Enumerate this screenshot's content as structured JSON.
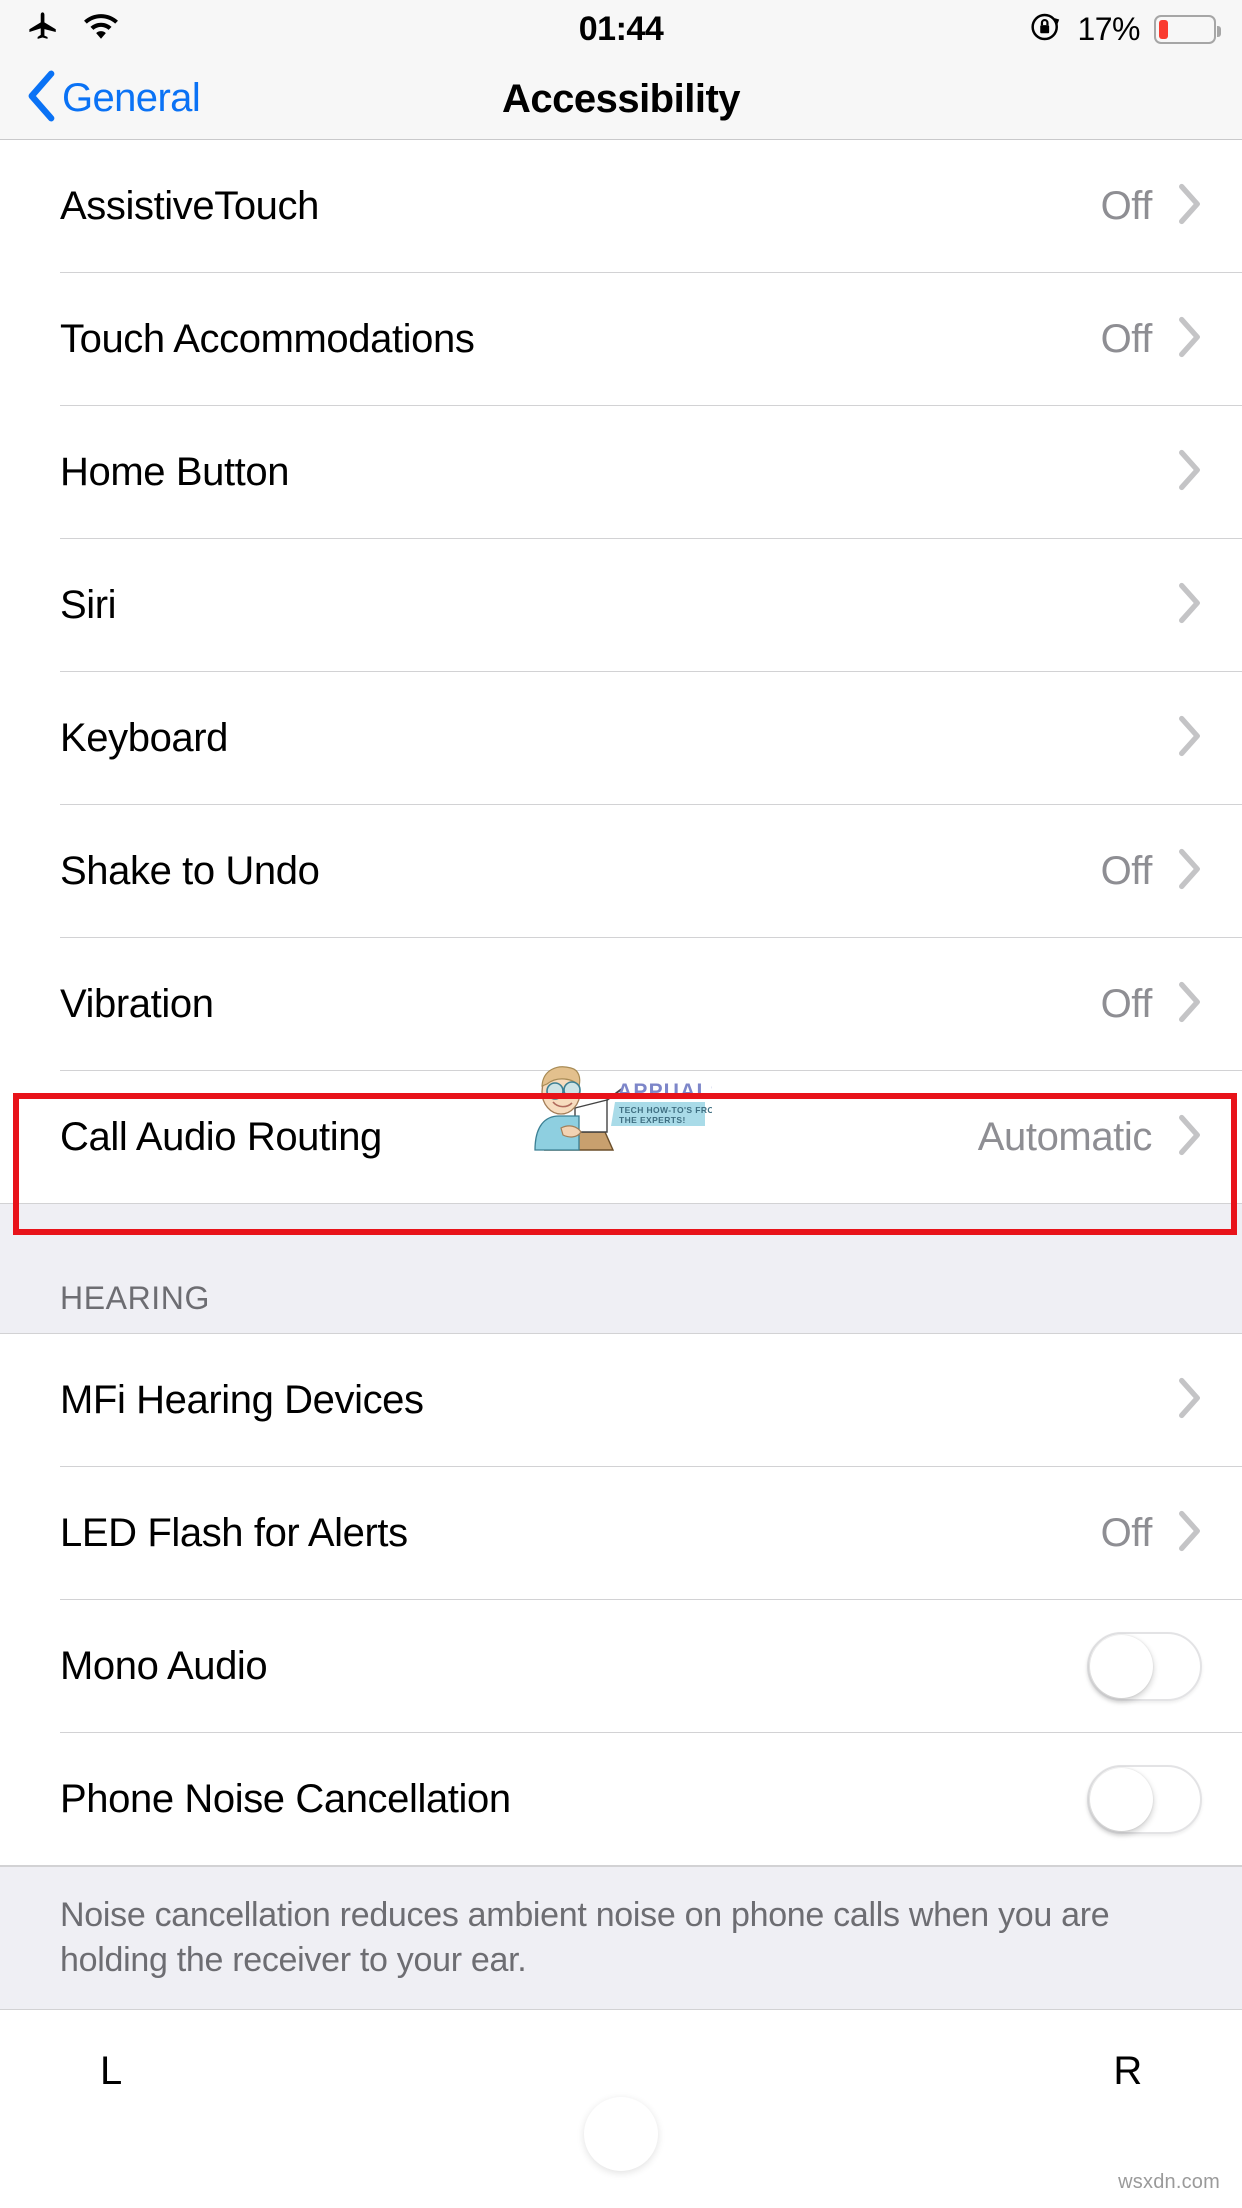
{
  "status_bar": {
    "airplane_icon": "airplane-icon",
    "wifi_icon": "wifi-icon",
    "time": "01:44",
    "rotation_lock_icon": "rotation-lock-icon",
    "battery_percent_label": "17%",
    "battery_level": 17,
    "battery_color": "#fa3b2f"
  },
  "nav_bar": {
    "back_label": "General",
    "back_icon": "chevron-left-icon",
    "title": "Accessibility",
    "tint_color": "#0a72f5"
  },
  "sections": [
    {
      "header": "",
      "rows": [
        {
          "label": "AssistiveTouch",
          "value": "Off",
          "accessory": "chevron"
        },
        {
          "label": "Touch Accommodations",
          "value": "Off",
          "accessory": "chevron"
        },
        {
          "label": "Home Button",
          "value": "",
          "accessory": "chevron"
        },
        {
          "label": "Siri",
          "value": "",
          "accessory": "chevron"
        },
        {
          "label": "Keyboard",
          "value": "",
          "accessory": "chevron"
        },
        {
          "label": "Shake to Undo",
          "value": "Off",
          "accessory": "chevron"
        },
        {
          "label": "Vibration",
          "value": "Off",
          "accessory": "chevron"
        },
        {
          "label": "Call Audio Routing",
          "value": "Automatic",
          "accessory": "chevron",
          "highlighted": true
        }
      ],
      "footer": ""
    },
    {
      "header": "HEARING",
      "rows": [
        {
          "label": "MFi Hearing Devices",
          "value": "",
          "accessory": "chevron"
        },
        {
          "label": "LED Flash for Alerts",
          "value": "Off",
          "accessory": "chevron"
        },
        {
          "label": "Mono Audio",
          "value": "",
          "accessory": "toggle",
          "toggle_on": false
        },
        {
          "label": "Phone Noise Cancellation",
          "value": "",
          "accessory": "toggle",
          "toggle_on": false
        }
      ],
      "footer": "Noise cancellation reduces ambient noise on phone calls when you are holding the receiver to your ear."
    }
  ],
  "balance_slider": {
    "left_label": "L",
    "right_label": "R",
    "value_position_percent": 50
  },
  "annotation": {
    "highlight_color": "#e8131a",
    "highlighted_row_label": "Call Audio Routing"
  },
  "watermarks": {
    "brand_name": "APPUALS",
    "brand_tagline_line1": "TECH HOW-TO'S FROM",
    "brand_tagline_line2": "THE EXPERTS!",
    "site": "wsxdn.com"
  }
}
